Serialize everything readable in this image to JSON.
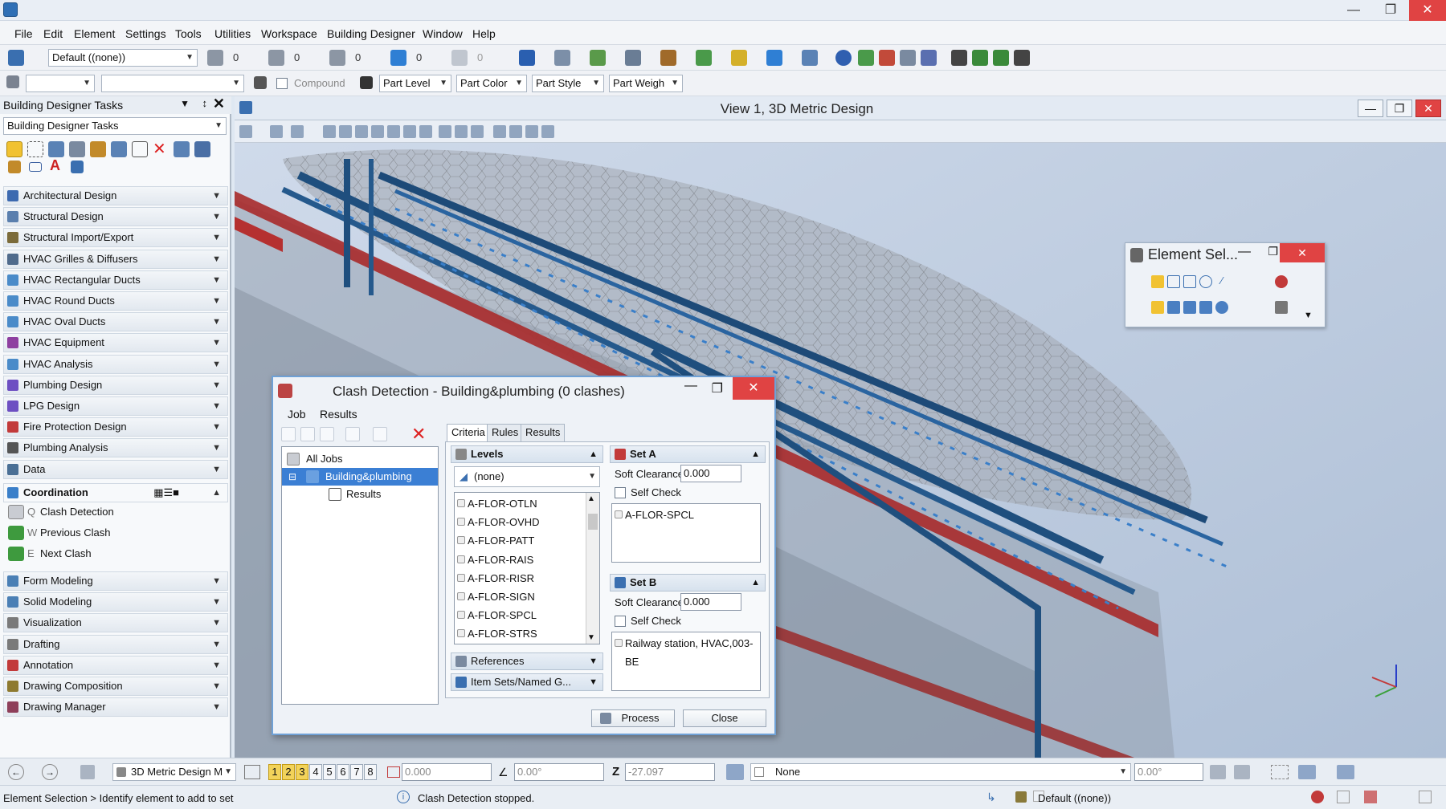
{
  "menubar": {
    "items": [
      "File",
      "Edit",
      "Element",
      "Settings",
      "Tools",
      "Utilities",
      "Workspace",
      "Building Designer",
      "Window",
      "Help"
    ]
  },
  "toolbar1": {
    "level_combo": "Default ((none))",
    "counts": [
      "0",
      "0",
      "0",
      "0",
      "0"
    ]
  },
  "toolbar2": {
    "compound_label": "Compound",
    "part_level": "Part Level",
    "part_color": "Part Color",
    "part_style": "Part Style",
    "part_weight": "Part Weigh"
  },
  "tasks": {
    "header": "Building Designer Tasks",
    "combo": "Building Designer Tasks",
    "categories": [
      {
        "label": "Architectural Design",
        "color": "#3d6ab0"
      },
      {
        "label": "Structural Design",
        "color": "#5a7fae"
      },
      {
        "label": "Structural Import/Export",
        "color": "#7b6b3a"
      },
      {
        "label": "HVAC Grilles & Diffusers",
        "color": "#506b8c"
      },
      {
        "label": "HVAC Rectangular Ducts",
        "color": "#4a8bc9"
      },
      {
        "label": "HVAC Round Ducts",
        "color": "#4a8bc9"
      },
      {
        "label": "HVAC Oval Ducts",
        "color": "#4a8bc9"
      },
      {
        "label": "HVAC Equipment",
        "color": "#8e3fa0"
      },
      {
        "label": "HVAC Analysis",
        "color": "#4a8bc9"
      },
      {
        "label": "Plumbing Design",
        "color": "#6d4fc2"
      },
      {
        "label": "LPG Design",
        "color": "#6d4fc2"
      },
      {
        "label": "Fire Protection Design",
        "color": "#c23a3a"
      },
      {
        "label": "Plumbing Analysis",
        "color": "#555"
      },
      {
        "label": "Data",
        "color": "#4a6f95"
      }
    ],
    "coordination": {
      "label": "Coordination",
      "items": [
        {
          "label": "Clash Detection",
          "key": "Q"
        },
        {
          "label": "Previous Clash",
          "key": "W"
        },
        {
          "label": "Next Clash",
          "key": "E"
        }
      ]
    },
    "categories_after": [
      {
        "label": "Form Modeling",
        "color": "#4a7fb5"
      },
      {
        "label": "Solid Modeling",
        "color": "#4a7fb5"
      },
      {
        "label": "Visualization",
        "color": "#7a7a7a"
      },
      {
        "label": "Drafting",
        "color": "#7a7a7a"
      },
      {
        "label": "Annotation",
        "color": "#c23a3a"
      },
      {
        "label": "Drawing Composition",
        "color": "#8e7a2f"
      },
      {
        "label": "Drawing Manager",
        "color": "#8e3f5a"
      }
    ]
  },
  "view": {
    "title": "View 1, 3D Metric Design"
  },
  "element_selection": {
    "title": "Element Sel..."
  },
  "clash": {
    "title": "Clash Detection - Building&plumbing (0 clashes)",
    "menu": {
      "job": "Job",
      "results": "Results"
    },
    "tree": {
      "all_jobs": "All Jobs",
      "job": "Building&plumbing",
      "results": "Results"
    },
    "tabs": [
      "Criteria",
      "Rules",
      "Results"
    ],
    "levels": {
      "header": "Levels",
      "combo": "(none)",
      "items": [
        "A-FLOR-OTLN",
        "A-FLOR-OVHD",
        "A-FLOR-PATT",
        "A-FLOR-RAIS",
        "A-FLOR-RISR",
        "A-FLOR-SIGN",
        "A-FLOR-SPCL",
        "A-FLOR-STRS"
      ]
    },
    "references_label": "References",
    "item_sets_label": "Item Sets/Named G...",
    "set_a": {
      "header": "Set A",
      "soft_clearance_label": "Soft Clearance:",
      "soft_clearance": "0.000",
      "self_check": "Self Check",
      "item": "A-FLOR-SPCL"
    },
    "set_b": {
      "header": "Set B",
      "soft_clearance_label": "Soft Clearance:",
      "soft_clearance": "0.000",
      "self_check": "Self Check",
      "item": "Railway station, HVAC,003-BE"
    },
    "process_label": "Process",
    "close_label": "Close"
  },
  "bottombar": {
    "model_combo": "3D Metric Design M",
    "view_numbers": [
      "1",
      "2",
      "3",
      "4",
      "5",
      "6",
      "7",
      "8"
    ],
    "x_value": "0.000",
    "angle_value": "0.00°",
    "z_label": "Z",
    "z_value": "-27.097",
    "none_combo": "None",
    "angle2_value": "0.00°"
  },
  "statusbar": {
    "prompt": "Element Selection > Identify element to add to set",
    "message": "Clash Detection stopped.",
    "level": "Default ((none))"
  }
}
